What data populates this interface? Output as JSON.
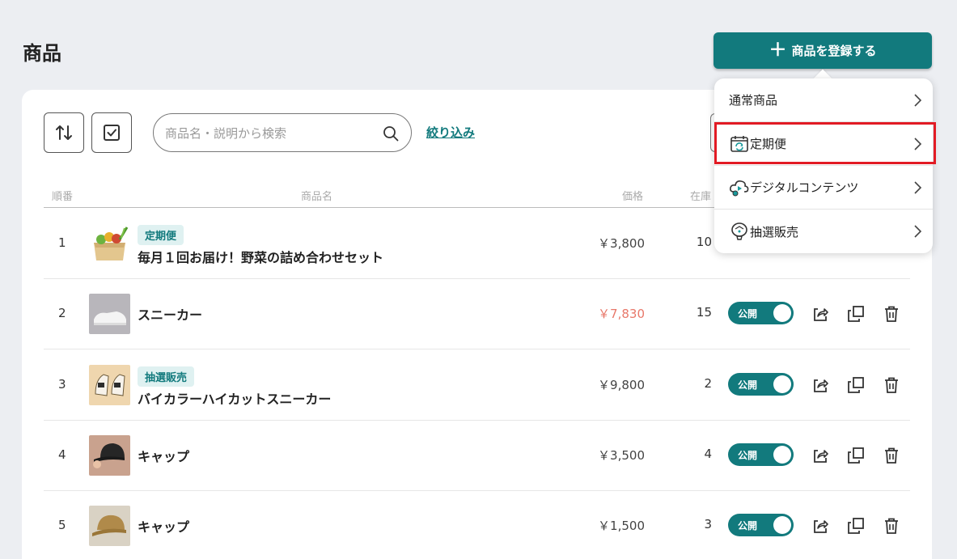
{
  "header": {
    "title": "商品",
    "register_label": "商品を登録する"
  },
  "toolbar": {
    "search_placeholder": "商品名・説明から検索",
    "filter_label": "絞り込み"
  },
  "table": {
    "columns": {
      "order": "順番",
      "name": "商品名",
      "price": "価格",
      "stock": "在庫"
    },
    "rows": [
      {
        "order": "1",
        "badge": "定期便",
        "name": "毎月１回お届け！野菜の詰め合わせセット",
        "price": "￥3,800",
        "stock": "10",
        "status": ""
      },
      {
        "order": "2",
        "badge": "",
        "name": "スニーカー",
        "price": "￥7,830",
        "stock": "15",
        "status": "公開"
      },
      {
        "order": "3",
        "badge": "抽選販売",
        "name": "バイカラーハイカットスニーカー",
        "price": "￥9,800",
        "stock": "2",
        "status": "公開"
      },
      {
        "order": "4",
        "badge": "",
        "name": "キャップ",
        "price": "￥3,500",
        "stock": "4",
        "status": "公開"
      },
      {
        "order": "5",
        "badge": "",
        "name": "キャップ",
        "price": "￥1,500",
        "stock": "3",
        "status": "公開"
      }
    ]
  },
  "dropdown": {
    "items": [
      {
        "label": "通常商品",
        "icon": "none"
      },
      {
        "label": "定期便",
        "icon": "calendar-refresh-icon"
      },
      {
        "label": "デジタルコンテンツ",
        "icon": "cloud-play-icon"
      },
      {
        "label": "抽選販売",
        "icon": "lottery-icon"
      }
    ]
  },
  "colors": {
    "accent": "#127a7d",
    "sale_price": "#e8786a",
    "highlight": "#e21b24"
  }
}
